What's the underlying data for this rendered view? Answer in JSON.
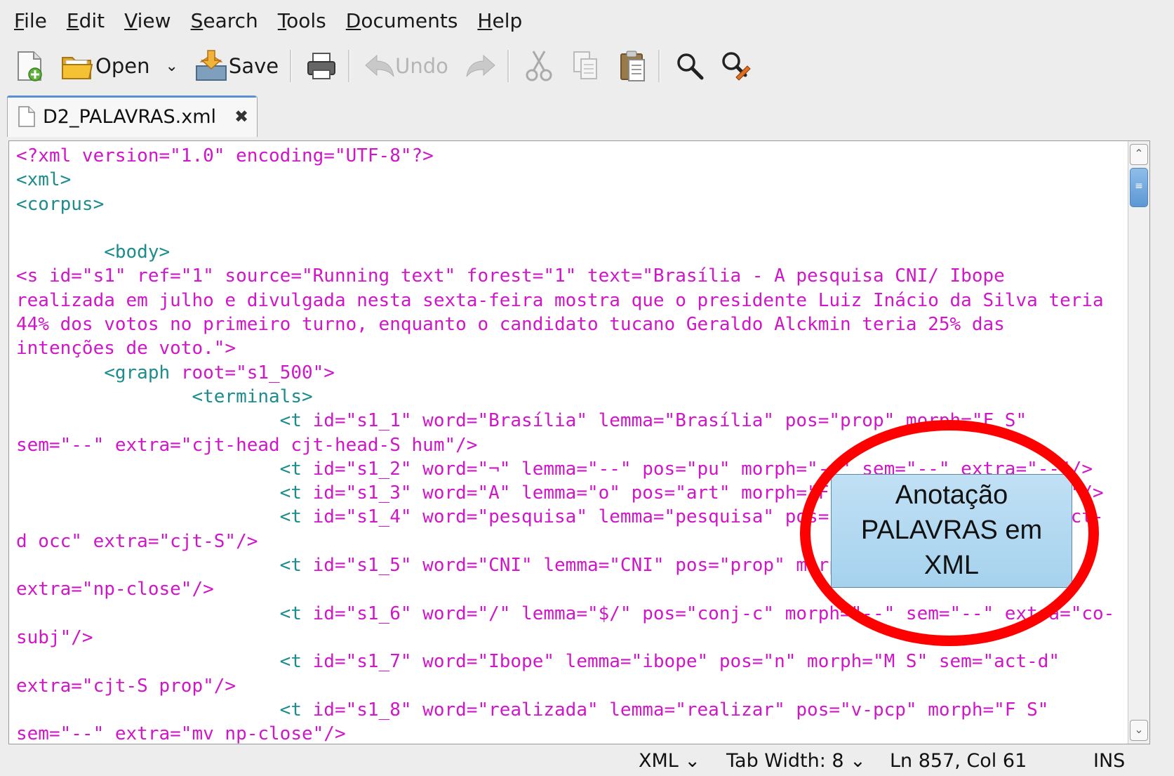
{
  "menu": [
    "File",
    "Edit",
    "View",
    "Search",
    "Tools",
    "Documents",
    "Help"
  ],
  "menu_mnemonics": [
    "F",
    "E",
    "V",
    "S",
    "T",
    "D",
    "H"
  ],
  "toolbar": {
    "new_icon": "new-document-icon",
    "open_label": "Open",
    "save_label": "Save",
    "undo_label": "Undo"
  },
  "tab": {
    "title": "D2_PALAVRAS.xml",
    "close_glyph": "✖"
  },
  "code_lines": [
    [
      {
        "c": "mg",
        "t": "<?xml version=\"1.0\" encoding=\"UTF-8\"?>"
      }
    ],
    [
      {
        "c": "tl",
        "t": "<xml>"
      }
    ],
    [
      {
        "c": "tl",
        "t": "<corpus>"
      }
    ],
    [
      {
        "c": "tl",
        "t": ""
      }
    ],
    [
      {
        "c": "tl",
        "t": "        <body>"
      }
    ],
    [
      {
        "c": "mg",
        "t": "<s id=\"s1\" ref=\"1\" source=\"Running text\" forest=\"1\" text=\"Brasília - A pesquisa CNI/ Ibope"
      }
    ],
    [
      {
        "c": "mg",
        "t": "realizada em julho e divulgada nesta sexta-feira mostra que o presidente Luiz Inácio da Silva teria"
      }
    ],
    [
      {
        "c": "mg",
        "t": "44% dos votos no primeiro turno, enquanto o candidato tucano Geraldo Alckmin teria 25% das"
      }
    ],
    [
      {
        "c": "mg",
        "t": "intenções de voto.\">"
      }
    ],
    [
      {
        "c": "tl",
        "t": "        <graph "
      },
      {
        "c": "mg",
        "t": "root=\"s1_500\">"
      }
    ],
    [
      {
        "c": "tl",
        "t": "                <terminals>"
      }
    ],
    [
      {
        "c": "tl",
        "t": "                        <t "
      },
      {
        "c": "mg",
        "t": "id=\"s1_1\" word=\"Brasília\" lemma=\"Brasília\" pos=\"prop\" morph=\"F S\""
      }
    ],
    [
      {
        "c": "mg",
        "t": "sem=\"--\" extra=\"cjt-head cjt-head-S hum\"/>"
      }
    ],
    [
      {
        "c": "tl",
        "t": "                        <t "
      },
      {
        "c": "mg",
        "t": "id=\"s1_2\" word=\"¬\" lemma=\"--\" pos=\"pu\" morph=\"--\" sem=\"--\" extra=\"--\"/>"
      }
    ],
    [
      {
        "c": "tl",
        "t": "                        <t "
      },
      {
        "c": "mg",
        "t": "id=\"s1_3\" word=\"A\" lemma=\"o\" pos=\"art\" morph=\"F S\" sem=\"--\" extra=\"--\"/>"
      }
    ],
    [
      {
        "c": "tl",
        "t": "                        <t "
      },
      {
        "c": "mg",
        "t": "id=\"s1_4\" word=\"pesquisa\" lemma=\"pesquisa\" pos=\"n\" morph=\"F S\" sem=\"act-"
      }
    ],
    [
      {
        "c": "mg",
        "t": "d occ\" extra=\"cjt-S\"/>"
      }
    ],
    [
      {
        "c": "tl",
        "t": "                        <t "
      },
      {
        "c": "mg",
        "t": "id=\"s1_5\" word=\"CNI\" lemma=\"CNI\" pos=\"prop\" morph=\"M S\" sem=\"--\""
      }
    ],
    [
      {
        "c": "mg",
        "t": "extra=\"np-close\"/>"
      }
    ],
    [
      {
        "c": "tl",
        "t": "                        <t "
      },
      {
        "c": "mg",
        "t": "id=\"s1_6\" word=\"/\" lemma=\"$/\" pos=\"conj-c\" morph=\"--\" sem=\"--\" extra=\"co-"
      }
    ],
    [
      {
        "c": "mg",
        "t": "subj\"/>"
      }
    ],
    [
      {
        "c": "tl",
        "t": "                        <t "
      },
      {
        "c": "mg",
        "t": "id=\"s1_7\" word=\"Ibope\" lemma=\"ibope\" pos=\"n\" morph=\"M S\" sem=\"act-d\""
      }
    ],
    [
      {
        "c": "mg",
        "t": "extra=\"cjt-S prop\"/>"
      }
    ],
    [
      {
        "c": "tl",
        "t": "                        <t "
      },
      {
        "c": "mg",
        "t": "id=\"s1_8\" word=\"realizada\" lemma=\"realizar\" pos=\"v-pcp\" morph=\"F S\""
      }
    ],
    [
      {
        "c": "mg",
        "t": "sem=\"--\" extra=\"mv np-close\"/>"
      }
    ]
  ],
  "colors": {
    "magenta": "#d016c8",
    "teal": "#1c8c8c",
    "annotation_red": "#ff0000",
    "callout_fill": "#b3d9f1"
  },
  "statusbar": {
    "language": "XML ⌄",
    "tab_width": "Tab Width:  8 ⌄",
    "position": "Ln 857, Col 61",
    "mode": "INS"
  },
  "annotation": {
    "line1": "Anotação",
    "line2": "PALAVRAS em",
    "line3": "XML"
  }
}
